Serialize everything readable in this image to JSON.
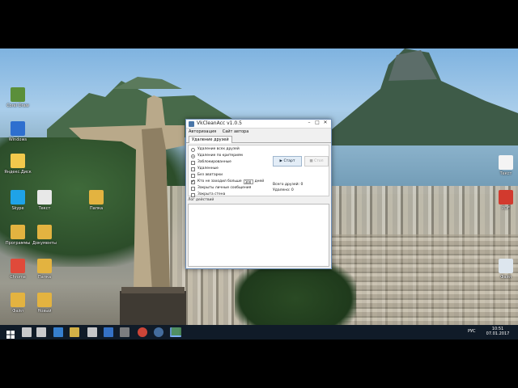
{
  "window": {
    "title": "VkCleanAcc v1.0.5",
    "minimize": "–",
    "maximize": "□",
    "close": "✕",
    "menu": [
      "Авторизация",
      "Сайт автора"
    ],
    "tab": "Удаление друзей",
    "options": [
      {
        "label": "Удаление всех друзей",
        "kind": "radio",
        "checked": false
      },
      {
        "label": "Удаление по критериям",
        "kind": "radio",
        "checked": true
      },
      {
        "label": "Заблокированные",
        "kind": "checkbox",
        "checked": false
      },
      {
        "label": "Удаленные",
        "kind": "checkbox",
        "checked": false
      },
      {
        "label": "Без аватарки",
        "kind": "checkbox",
        "checked": false
      },
      {
        "label": "Кто не заходил больше",
        "kind": "checkbox",
        "checked": true
      },
      {
        "label": "Закрыты личные сообщения",
        "kind": "checkbox",
        "checked": false
      },
      {
        "label": "Закрыта стена",
        "kind": "checkbox",
        "checked": false
      }
    ],
    "days_value": "300",
    "days_unit": "дней",
    "start_label": "▶ Старт",
    "stop_label": "■ Стоп",
    "total_friends": "Всего друзей: 0",
    "deleted": "Удалено: 0",
    "log_title": "Лог действий"
  },
  "desktop_icons": [
    {
      "label": "Corel Draw",
      "color": "#5b8f3a"
    },
    {
      "label": "Windows",
      "color": "#2e6fcf"
    },
    {
      "label": "Яндекс.Диск",
      "color": "#f2c94c"
    },
    {
      "label": "Skype",
      "color": "#1fa3e8"
    },
    {
      "label": "Текст",
      "color": "#e8e8e8"
    },
    {
      "label": "Папка",
      "color": "#e3b340"
    },
    {
      "label": "Программы",
      "color": "#e3b340"
    },
    {
      "label": "Документы",
      "color": "#e3b340"
    },
    {
      "label": "Chrome",
      "color": "#e04a3a"
    },
    {
      "label": "Папка",
      "color": "#e3b340"
    },
    {
      "label": "Файл",
      "color": "#e3b340"
    },
    {
      "label": "Новый",
      "color": "#e3b340"
    },
    {
      "label": "Текст",
      "color": "#f4f4f4"
    },
    {
      "label": "PDF",
      "color": "#d23a2e"
    },
    {
      "label": "Файл",
      "color": "#dde6ee"
    }
  ],
  "taskbar": {
    "icons": [
      "windows-start",
      "search",
      "task-view",
      "edge",
      "explorer",
      "store",
      "mail",
      "calculator",
      "chrome",
      "vk",
      "app",
      "vkcleanacc"
    ],
    "lang": "РУС",
    "time": "10:51",
    "date": "07.01.2017"
  }
}
